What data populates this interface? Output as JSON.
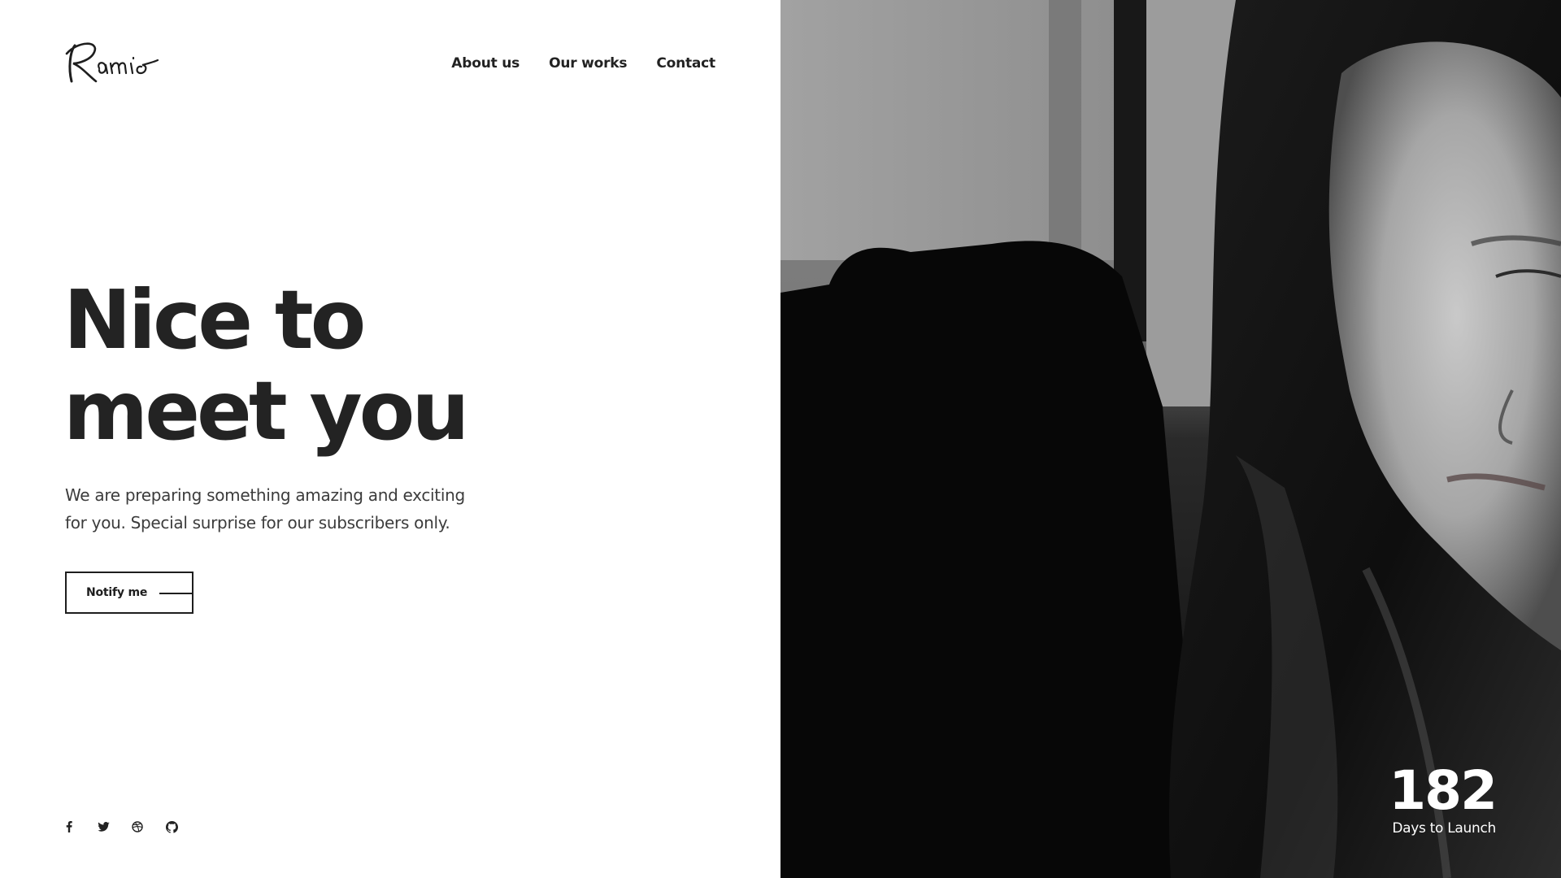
{
  "brand": {
    "logo_text": "Ramio"
  },
  "nav": {
    "items": [
      {
        "label": "About us"
      },
      {
        "label": "Our works"
      },
      {
        "label": "Contact"
      }
    ]
  },
  "hero": {
    "headline_line1": "Nice to",
    "headline_line2": "meet you",
    "subtitle_line1": "We are preparing something amazing and exciting",
    "subtitle_line2": "for you. Special surprise for our subscribers only.",
    "notify_label": "Notify me"
  },
  "social": {
    "icons": [
      "facebook-icon",
      "twitter-icon",
      "dribbble-icon",
      "github-icon"
    ]
  },
  "countdown": {
    "value": "182",
    "label": "Days to Launch"
  },
  "colors": {
    "text": "#232323",
    "background": "#ffffff",
    "photo_tone": "grayscale"
  }
}
